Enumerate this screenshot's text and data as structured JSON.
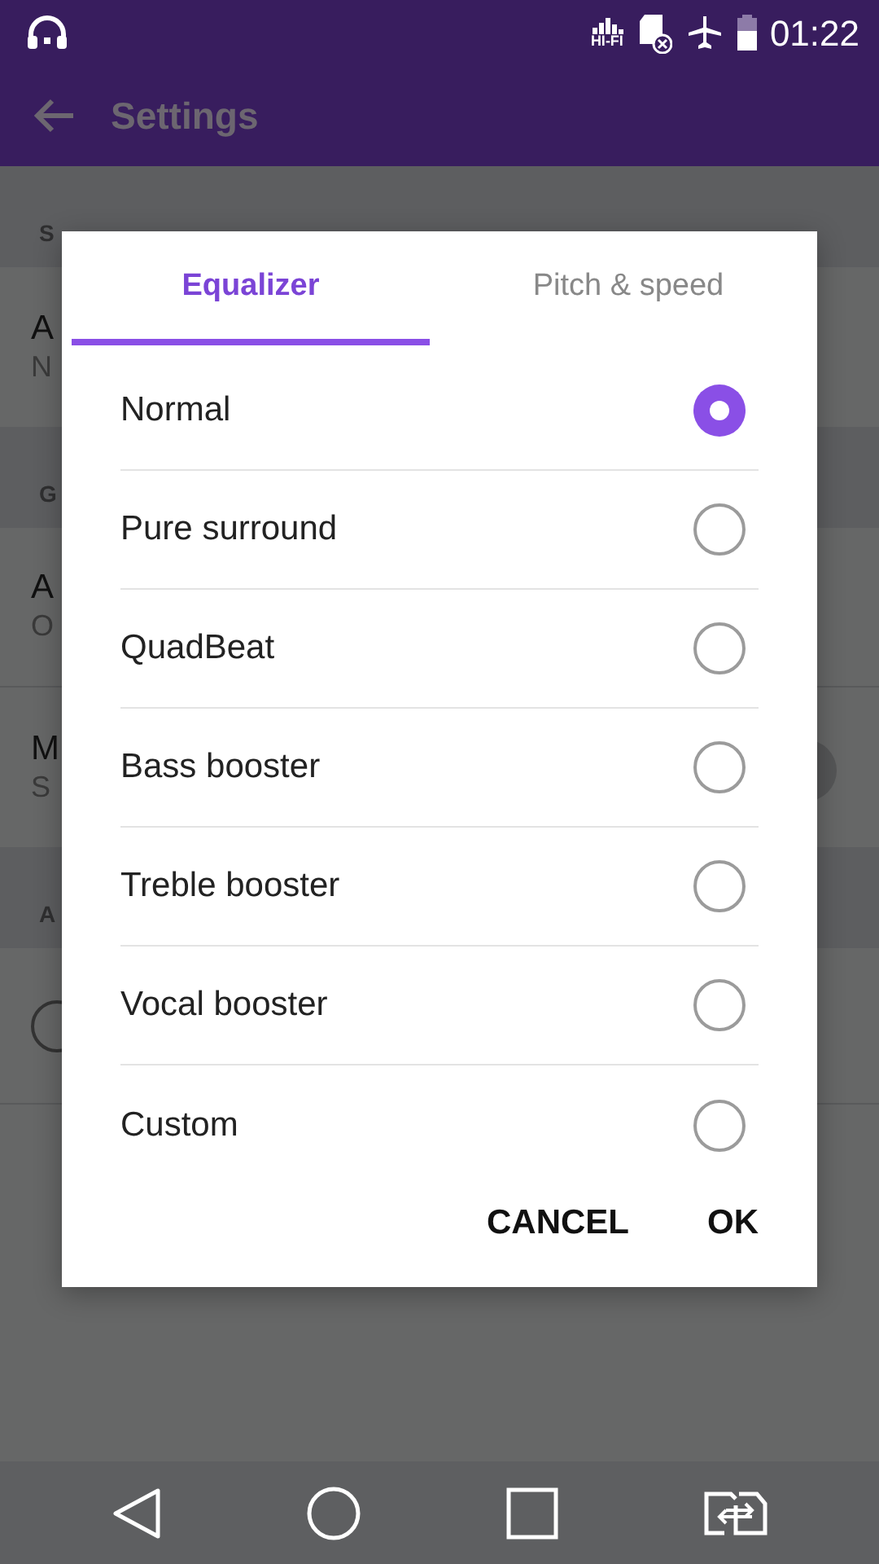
{
  "status_bar": {
    "hifi_label": "HI-FI",
    "time": "01:22"
  },
  "app_bar": {
    "title": "Settings"
  },
  "background": [
    {
      "kind": "header",
      "text": "S"
    },
    {
      "kind": "item",
      "title": "A",
      "subtitle": "N"
    },
    {
      "kind": "header",
      "text": "G"
    },
    {
      "kind": "item",
      "title": "A",
      "subtitle": "O"
    },
    {
      "kind": "switch",
      "title": "M",
      "subtitle": "S"
    },
    {
      "kind": "header",
      "text": "A"
    },
    {
      "kind": "add"
    }
  ],
  "dialog": {
    "tabs": [
      {
        "label": "Equalizer",
        "selected": true
      },
      {
        "label": "Pitch & speed",
        "selected": false
      }
    ],
    "options": [
      {
        "label": "Normal",
        "selected": true
      },
      {
        "label": "Pure surround",
        "selected": false
      },
      {
        "label": "QuadBeat",
        "selected": false
      },
      {
        "label": "Bass booster",
        "selected": false
      },
      {
        "label": "Treble booster",
        "selected": false
      },
      {
        "label": "Vocal booster",
        "selected": false
      },
      {
        "label": "Custom",
        "selected": false
      }
    ],
    "buttons": [
      "CANCEL",
      "OK"
    ]
  }
}
